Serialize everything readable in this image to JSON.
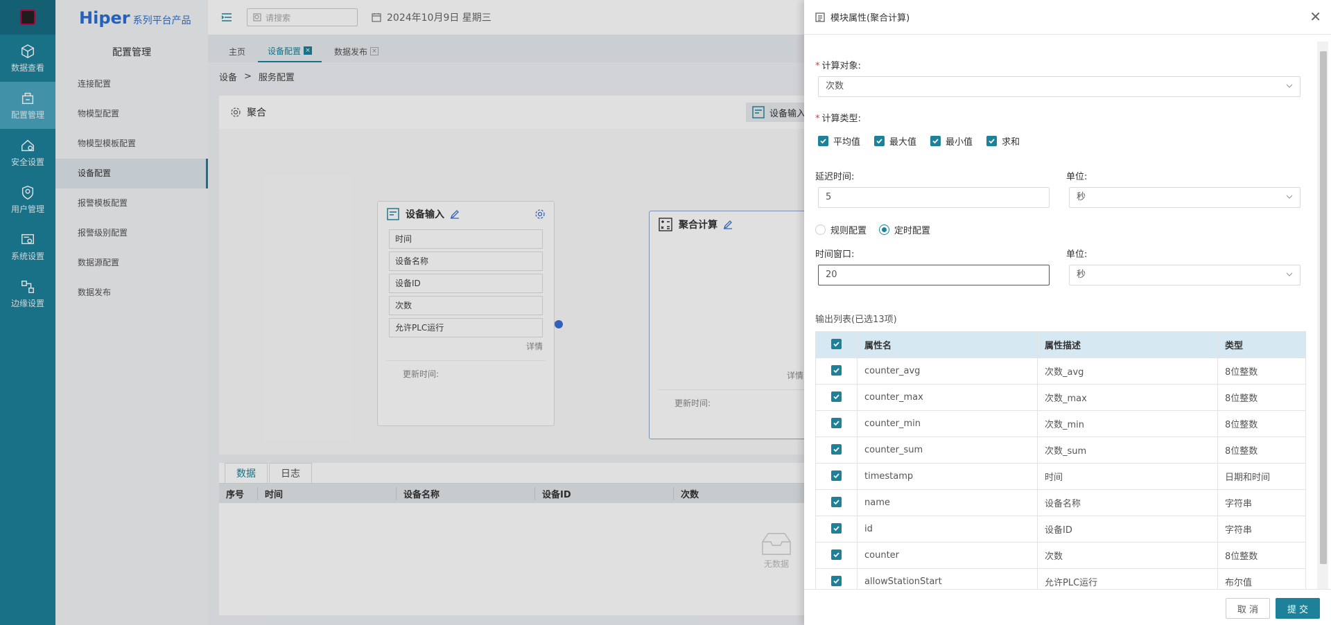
{
  "nav": {
    "items": [
      {
        "label": "数据查看",
        "icon": "cube-icon"
      },
      {
        "label": "配置管理",
        "icon": "config-icon",
        "active": true
      },
      {
        "label": "安全设置",
        "icon": "security-icon"
      },
      {
        "label": "用户管理",
        "icon": "user-icon"
      },
      {
        "label": "系统设置",
        "icon": "system-icon"
      },
      {
        "label": "边缘设置",
        "icon": "edge-icon"
      }
    ]
  },
  "brand": {
    "name": "Hiper",
    "suffix": "系列平台产品"
  },
  "sidebar": {
    "title": "配置管理",
    "items": [
      "连接配置",
      "物模型配置",
      "物模型模板配置",
      "设备配置",
      "报警模板配置",
      "报警级别配置",
      "数据源配置",
      "数据发布"
    ],
    "active": "设备配置"
  },
  "topbar": {
    "search_placeholder": "请搜索",
    "date": "2024年10月9日 星期三"
  },
  "tabs": [
    {
      "label": "主页"
    },
    {
      "label": "设备配置",
      "active": true
    },
    {
      "label": "数据发布"
    }
  ],
  "breadcrumb": [
    "设备",
    "服务配置"
  ],
  "canvas": {
    "title": "聚合",
    "toolbar_label": "设备输入",
    "node_input": {
      "title": "设备输入",
      "fields": [
        "时间",
        "设备名称",
        "设备ID",
        "次数",
        "允许PLC运行"
      ],
      "more": "详情",
      "update": "更新时间:"
    },
    "node_agg": {
      "title": "聚合计算",
      "more": "详情",
      "update": "更新时间:"
    }
  },
  "bottom": {
    "tabs": [
      "数据",
      "日志"
    ],
    "columns": [
      "序号",
      "时间",
      "设备名称",
      "设备ID",
      "次数"
    ],
    "empty": "无数据"
  },
  "drawer": {
    "title": "模块属性(聚合计算)",
    "calc_target_label": "计算对象:",
    "calc_target_value": "次数",
    "calc_type_label": "计算类型:",
    "calc_types": [
      "平均值",
      "最大值",
      "最小值",
      "求和"
    ],
    "delay_label": "延迟时间:",
    "delay_value": "5",
    "unit_label": "单位:",
    "delay_unit": "秒",
    "radio_options": [
      {
        "label": "规则配置",
        "checked": false
      },
      {
        "label": "定时配置",
        "checked": true
      }
    ],
    "window_label": "时间窗口:",
    "window_value": "20",
    "window_unit": "秒",
    "output_label": "输出列表(已选13项)",
    "table": {
      "headers": [
        "属性名",
        "属性描述",
        "类型"
      ],
      "rows": [
        [
          "counter_avg",
          "次数_avg",
          "8位整数"
        ],
        [
          "counter_max",
          "次数_max",
          "8位整数"
        ],
        [
          "counter_min",
          "次数_min",
          "8位整数"
        ],
        [
          "counter_sum",
          "次数_sum",
          "8位整数"
        ],
        [
          "timestamp",
          "时间",
          "日期和时间"
        ],
        [
          "name",
          "设备名称",
          "字符串"
        ],
        [
          "id",
          "设备ID",
          "字符串"
        ],
        [
          "counter",
          "次数",
          "8位整数"
        ],
        [
          "allowStationStart",
          "允许PLC运行",
          "布尔值"
        ]
      ]
    },
    "cancel": "取 消",
    "submit": "提 交"
  }
}
